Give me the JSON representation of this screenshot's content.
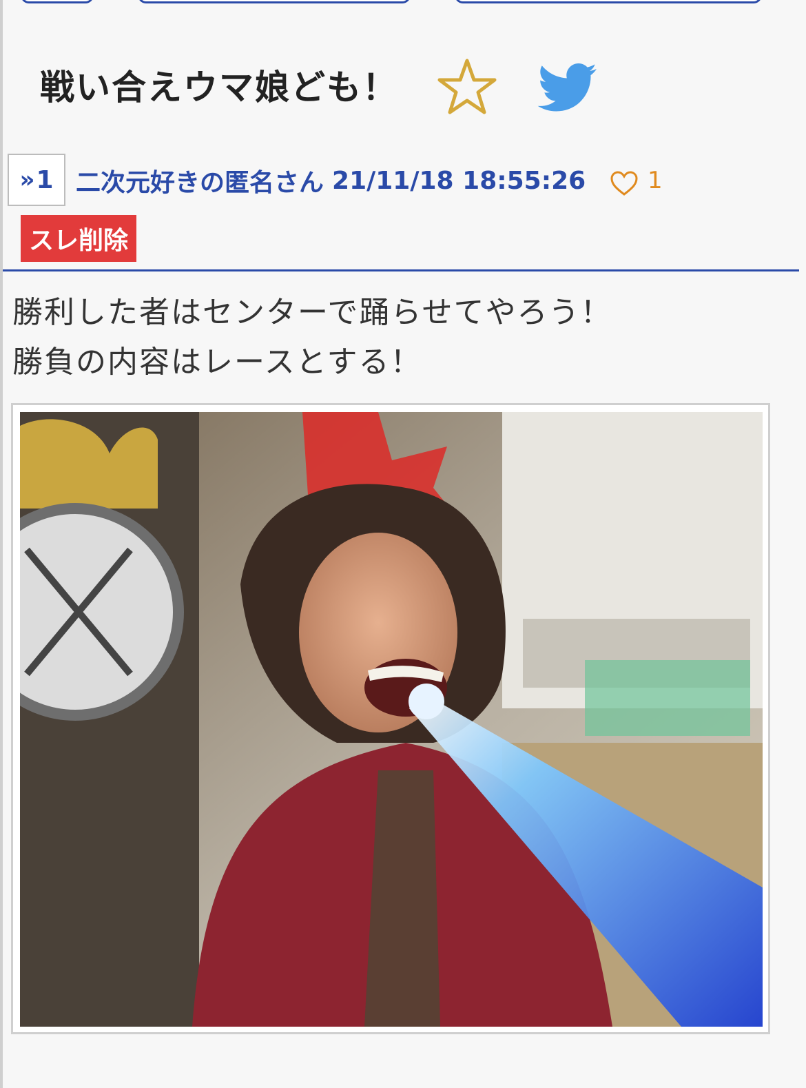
{
  "thread": {
    "title": "戦い合えウマ娘ども！"
  },
  "actions": {
    "favorite_icon": "star-icon",
    "share_icon": "twitter-icon"
  },
  "post": {
    "number": "1",
    "author": "二次元好きの匿名さん",
    "timestamp": "21/11/18 18:55:26",
    "likes": "1",
    "delete_label": "スレ削除",
    "lines": [
      "勝利した者はセンターで踊らせてやろう！",
      "勝負の内容はレースとする！"
    ]
  },
  "colors": {
    "accent": "#2a4aa8",
    "delete": "#e23b3b",
    "star": "#d4a83a",
    "twitter": "#4a9de8",
    "like": "#e08a1e"
  }
}
